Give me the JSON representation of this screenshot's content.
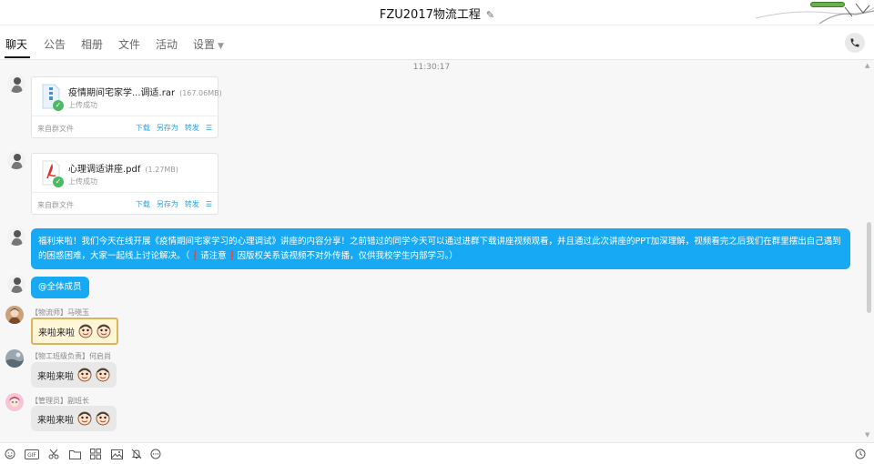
{
  "window": {
    "title": "FZU2017物流工程",
    "edit_icon": "pencil-icon"
  },
  "tabs": [
    {
      "label": "聊天",
      "active": true
    },
    {
      "label": "公告"
    },
    {
      "label": "相册"
    },
    {
      "label": "文件"
    },
    {
      "label": "活动"
    },
    {
      "label": "设置"
    }
  ],
  "chat": {
    "timestamp": "11:30:17",
    "files": [
      {
        "name": "疫情期间宅家学...调适.rar",
        "size": "(167.06MB)",
        "status": "上传成功",
        "source": "来自群文件",
        "actions": [
          "下载",
          "另存为",
          "转发"
        ],
        "icon": "archive-icon"
      },
      {
        "name": "心理调适讲座.pdf",
        "size": "(1.27MB)",
        "status": "上传成功",
        "source": "来自群文件",
        "actions": [
          "下载",
          "另存为",
          "转发"
        ],
        "icon": "pdf-icon"
      }
    ],
    "announcement": {
      "part1": "福利来啦！我们今天在线开展《疫情期间宅家学习的心理调试》讲座的内容分享！之前错过的同学今天可以通过进群下载讲座视频观看，并且通过此次讲座的PPT加深理解，视频看完之后我们在群里摆出自己遇到的困惑困难，大家一起线上讨论解决。（",
      "warn1": "❗",
      "part2": "请注意",
      "warn2": "❗",
      "part3": "因版权关系该视频不对外传播，仅供我校学生内部学习。）"
    },
    "mention": "@全体成员",
    "messages": [
      {
        "sender": "【物流师】马晓玉",
        "text": "来啦来啦"
      },
      {
        "sender": "【物工班级负责】何启尚",
        "text": "来啦来啦"
      },
      {
        "sender": "【管理员】副班长",
        "text": "来啦来啦"
      }
    ]
  },
  "toolbar": {
    "icons": [
      "smile-icon",
      "gif-icon",
      "scissors-icon",
      "folder-icon",
      "apps-icon",
      "image-icon",
      "bell-icon",
      "more-icon",
      "history-icon"
    ]
  },
  "colors": {
    "accent": "#18a9f5",
    "link": "#2ba1e6",
    "success": "#4cba63"
  }
}
